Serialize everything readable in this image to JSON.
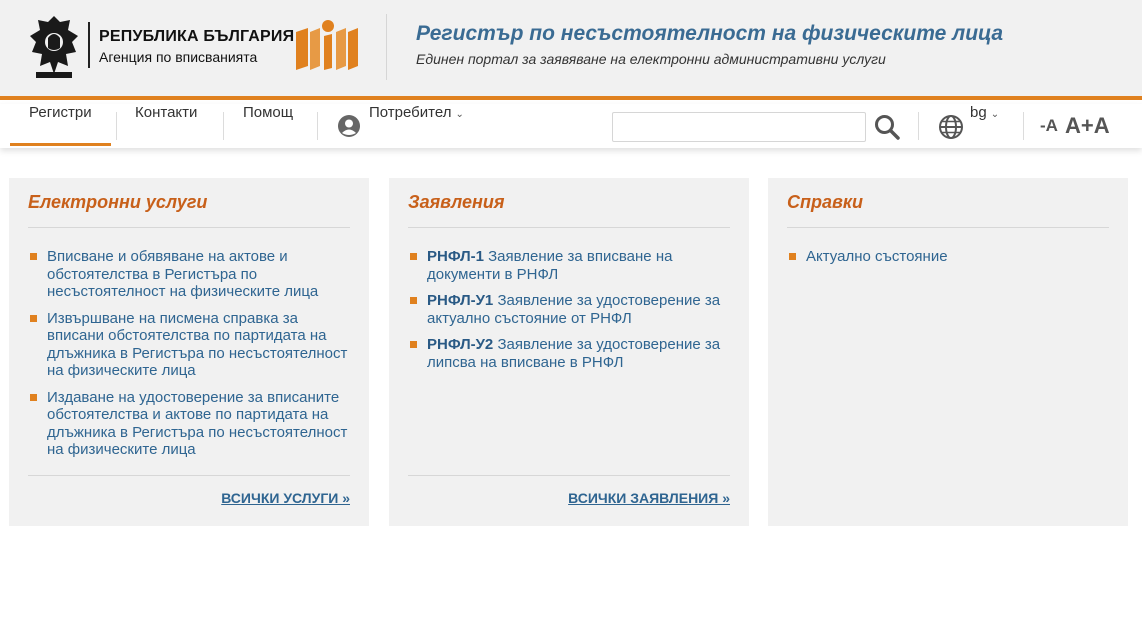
{
  "header": {
    "org_line1": "РЕПУБЛИКА БЪЛГАРИЯ",
    "org_line2": "Агенция по вписванията",
    "portal_title": "Регистър по несъстоятелност на физическите лица",
    "portal_subtitle": "Единен портал за заявяване на електронни административни услуги",
    "accent_color": "#e0811f",
    "title_color": "#3a6b93"
  },
  "nav": {
    "items": [
      {
        "label": "Регистри",
        "active": true
      },
      {
        "label": "Контакти"
      },
      {
        "label": "Помощ"
      }
    ],
    "user_label": "Потребител",
    "search": {
      "value": "",
      "placeholder": "",
      "icon": "search-icon"
    },
    "language": "bg",
    "font_decrease": "-A",
    "font_increase": "A+A"
  },
  "cards": [
    {
      "title": "Електронни услуги",
      "items": [
        {
          "text": "Вписване и обявяване на актове и обстоятелства в Регистъра по несъстоятелност на физическите лица"
        },
        {
          "text": "Извършване на писмена справка за вписани обстоятелства по партидата на длъжника в Регистъра по несъстоятелност на физическите лица"
        },
        {
          "text": "Издаване на удостоверение за вписаните обстоятелства и актове по партидата на длъжника в Регистъра по несъстоятелност на физическите лица"
        }
      ],
      "more": "ВСИЧКИ УСЛУГИ »"
    },
    {
      "title": "Заявления",
      "items": [
        {
          "code": "РНФЛ-1",
          "text": "Заявление за вписване на документи в РНФЛ"
        },
        {
          "code": "РНФЛ-У1",
          "text": "Заявление за удостоверение за актуално състояние от РНФЛ"
        },
        {
          "code": "РНФЛ-У2",
          "text": "Заявление за удостоверение за липсва на вписване в РНФЛ"
        }
      ],
      "more": "ВСИЧКИ ЗАЯВЛЕНИЯ »"
    },
    {
      "title": "Справки",
      "items": [
        {
          "text": "Актуално състояние"
        }
      ]
    }
  ]
}
